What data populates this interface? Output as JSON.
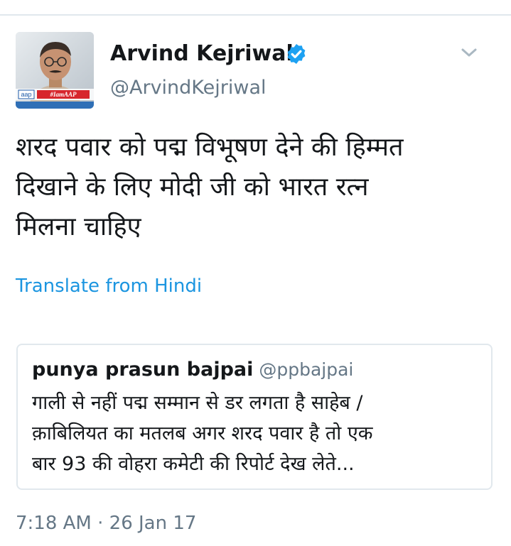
{
  "tweet": {
    "display_name": "Arvind Kejriwal",
    "handle": "@ArvindKejriwal",
    "verified": true,
    "avatar_badge_text": "aap",
    "avatar_hashtag_text": "#IamAAP",
    "text_lines": [
      "शरद पवार को पद्म विभूषण देने की हिम्मत",
      "दिखाने के लिए मोदी जी को भारत रत्न",
      "मिलना चाहिए"
    ],
    "translate_label": "Translate from Hindi",
    "timestamp": "7:18 AM · 26 Jan 17"
  },
  "quoted_tweet": {
    "display_name": "punya prasun bajpai",
    "handle": "@ppbajpai",
    "text_lines": [
      "गाली से नहीं पद्म सम्मान से डर लगता है साहेब /",
      "क़ाबिलियत का मतलब अगर शरद पवार है तो एक",
      "बार 93 की वोहरा कमेटी की रिपोर्ट देख लेते..."
    ]
  },
  "colors": {
    "text_primary": "#14171a",
    "text_secondary": "#657786",
    "link": "#1b95e0",
    "verified": "#1da1f2",
    "border": "#e1e8ed",
    "chevron": "#aab8c2"
  },
  "icons": {
    "verified": "verified-badge-icon",
    "menu": "chevron-down-icon"
  }
}
